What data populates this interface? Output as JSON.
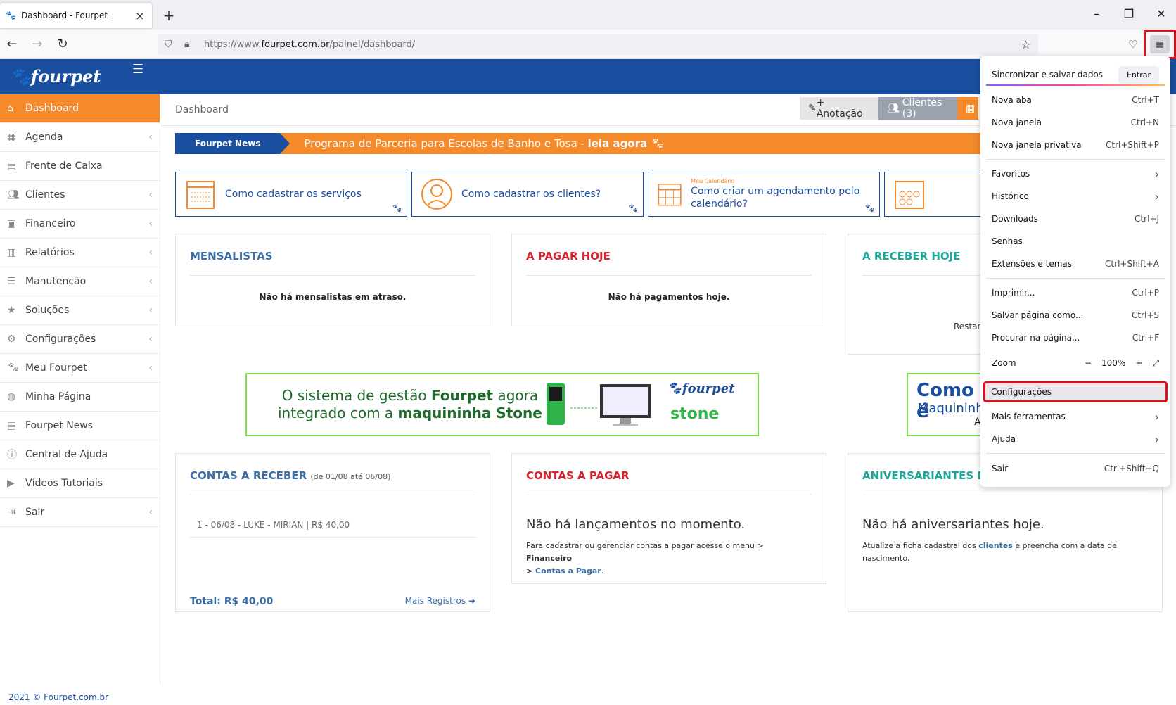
{
  "browser": {
    "tab_title": "Dashboard - Fourpet",
    "url_prefix": "https://www.",
    "url_domain": "fourpet.com.br",
    "url_path": "/painel/dashboard/"
  },
  "site": {
    "logo": "fourpet",
    "footer": "2021 © Fourpet.com.br"
  },
  "sidebar": {
    "items": [
      {
        "label": "Dashboard",
        "icon": "home-icon"
      },
      {
        "label": "Agenda",
        "icon": "calendar-icon"
      },
      {
        "label": "Frente de Caixa",
        "icon": "calculator-icon"
      },
      {
        "label": "Clientes",
        "icon": "users-icon"
      },
      {
        "label": "Financeiro",
        "icon": "money-icon"
      },
      {
        "label": "Relatórios",
        "icon": "bar-chart-icon"
      },
      {
        "label": "Manutenção",
        "icon": "database-icon"
      },
      {
        "label": "Soluções",
        "icon": "star-icon"
      },
      {
        "label": "Configurações",
        "icon": "cogs-icon"
      },
      {
        "label": "Meu Fourpet",
        "icon": "paw-icon"
      },
      {
        "label": "Minha Página",
        "icon": "globe-icon"
      },
      {
        "label": "Fourpet News",
        "icon": "newspaper-icon"
      },
      {
        "label": "Central de Ajuda",
        "icon": "info-icon"
      },
      {
        "label": "Vídeos Tutoriais",
        "icon": "video-icon"
      },
      {
        "label": "Sair",
        "icon": "sign-out-icon"
      }
    ]
  },
  "content": {
    "title": "Dashboard",
    "btn_anotacao": "+ Anotação",
    "btn_clientes": "Clientes (3)",
    "news_tag": "Fourpet News",
    "news_msg": "Programa de Parceria para Escolas de Banho e Tosa - ",
    "news_link": "leia agora",
    "cards": [
      {
        "text": "Como cadastrar os serviços",
        "small": ""
      },
      {
        "text": "Como cadastrar os clientes?",
        "small": ""
      },
      {
        "text": "Como criar um agendamento pelo calendário?",
        "small": "Meu Calendário"
      }
    ],
    "mensalistas_title": "MENSALISTAS",
    "mensalistas_msg": "Não há mensalistas em atraso.",
    "pagar_hoje_title": "A PAGAR HOJE",
    "pagar_hoje_msg": "Não há pagamentos hoje.",
    "receber_hoje_title": "A RECEBER HOJE",
    "receber_hoje_msg": "Restan",
    "banner_line1_a": "O sistema de gestão ",
    "banner_line1_b": "Fourpet",
    "banner_line1_c": " agora",
    "banner_line2_a": "integrado com a ",
    "banner_line2_b": "maquininha Stone",
    "banner_brand1": "fourpet",
    "banner_brand2": "stone",
    "banner2_a": "Como é",
    "banner2_b": "Maquininh",
    "banner2_c": "A",
    "contas_receber_title": "CONTAS A RECEBER",
    "contas_receber_range": "(de 01/08 até 06/08)",
    "contas_receber_item": "1 - 06/08 - LUKE - MIRIAN | R$ 40,00",
    "contas_receber_total": "Total: R$ 40,00",
    "contas_receber_more": "Mais Registros",
    "contas_pagar_title": "CONTAS A PAGAR",
    "contas_pagar_big": "Não há lançamentos no momento.",
    "contas_pagar_help_a": "Para cadastrar ou gerenciar contas a pagar acesse o menu > ",
    "contas_pagar_help_b": "Financeiro",
    "contas_pagar_help_c": "> ",
    "contas_pagar_help_d": "Contas a Pagar",
    "contas_pagar_help_e": ".",
    "aniv_title": "ANIVERSARIANTES DO",
    "aniv_big": "Não há aniversariantes hoje.",
    "aniv_help_a": "Atualize a ficha cadastral dos ",
    "aniv_help_b": "clientes",
    "aniv_help_c": " e preencha com a data de nascimento."
  },
  "menu": {
    "sync": "Sincronizar e salvar dados",
    "entrar": "Entrar",
    "items": [
      {
        "label": "Nova aba",
        "shortcut": "Ctrl+T"
      },
      {
        "label": "Nova janela",
        "shortcut": "Ctrl+N"
      },
      {
        "label": "Nova janela privativa",
        "shortcut": "Ctrl+Shift+P"
      },
      {
        "label": "Favoritos",
        "shortcut": "›"
      },
      {
        "label": "Histórico",
        "shortcut": "›"
      },
      {
        "label": "Downloads",
        "shortcut": "Ctrl+J"
      },
      {
        "label": "Senhas",
        "shortcut": ""
      },
      {
        "label": "Extensões e temas",
        "shortcut": "Ctrl+Shift+A"
      },
      {
        "label": "Imprimir...",
        "shortcut": "Ctrl+P"
      },
      {
        "label": "Salvar página como...",
        "shortcut": "Ctrl+S"
      },
      {
        "label": "Procurar na página...",
        "shortcut": "Ctrl+F"
      },
      {
        "label": "Configurações",
        "shortcut": ""
      },
      {
        "label": "Mais ferramentas",
        "shortcut": "›"
      },
      {
        "label": "Ajuda",
        "shortcut": "›"
      },
      {
        "label": "Sair",
        "shortcut": "Ctrl+Shift+Q"
      }
    ],
    "zoom_label": "Zoom",
    "zoom_minus": "−",
    "zoom_value": "100%",
    "zoom_plus": "+",
    "zoom_full": "⤢"
  },
  "colors": {
    "brand_blue": "#1a4fa0",
    "brand_orange": "#f58a2b",
    "highlight_red": "#d9121b"
  }
}
